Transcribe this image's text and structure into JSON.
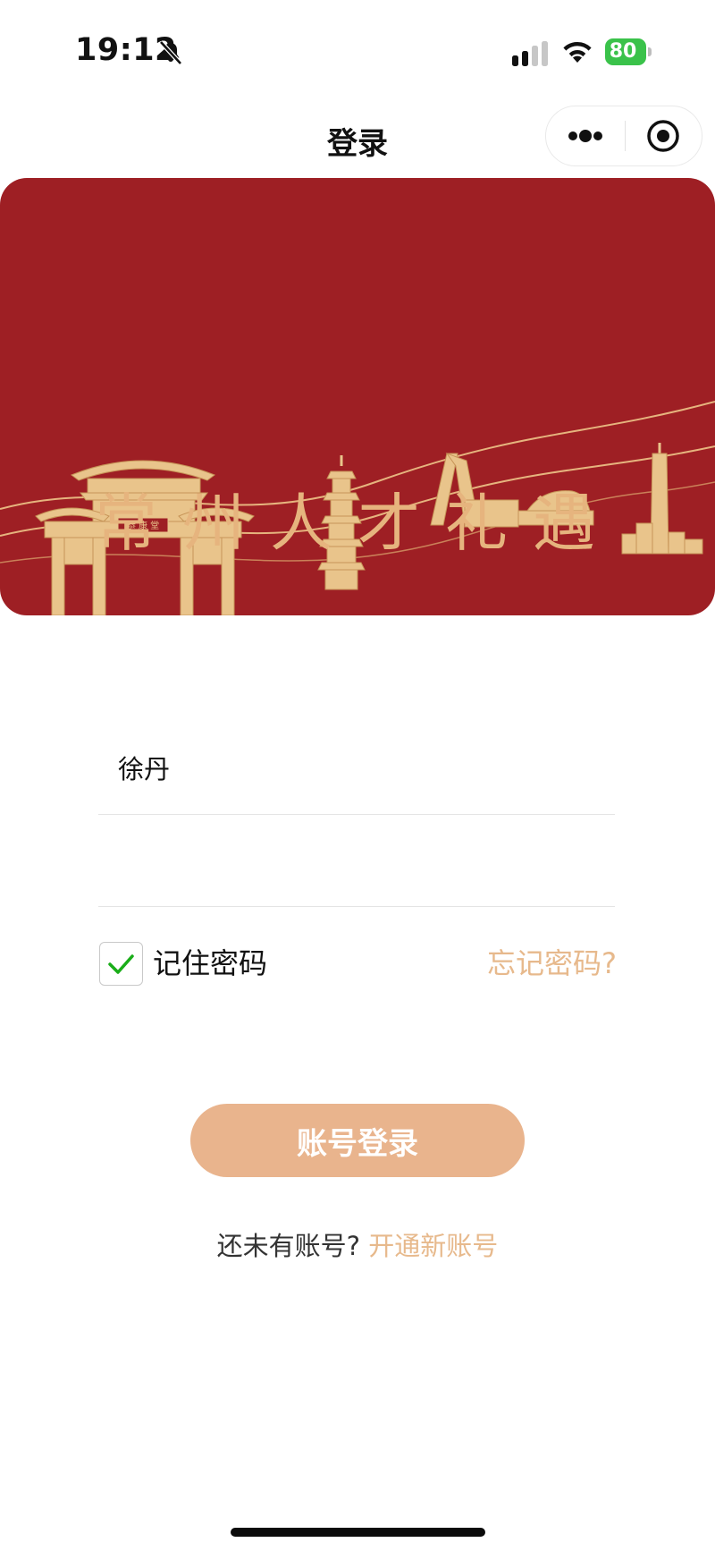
{
  "status_bar": {
    "time": "19:12",
    "bell_icon": "bell-slash-icon",
    "battery_level": "80",
    "accent": "#3ac24a"
  },
  "nav": {
    "title": "登录",
    "more_icon": "more-dots-icon",
    "close_icon": "target-close-icon"
  },
  "banner": {
    "title": "常州人才礼遇",
    "gate_plaque": "恭 康 堂",
    "background": "#9e1f24",
    "gold": "#e6b47e"
  },
  "form": {
    "username_value": "徐丹",
    "password_value": "",
    "remember_label": "记住密码",
    "remember_checked": true,
    "forgot_label": "忘记密码?",
    "login_label": "账号登录"
  },
  "signup": {
    "prompt": "还未有账号?",
    "link": "开通新账号"
  }
}
